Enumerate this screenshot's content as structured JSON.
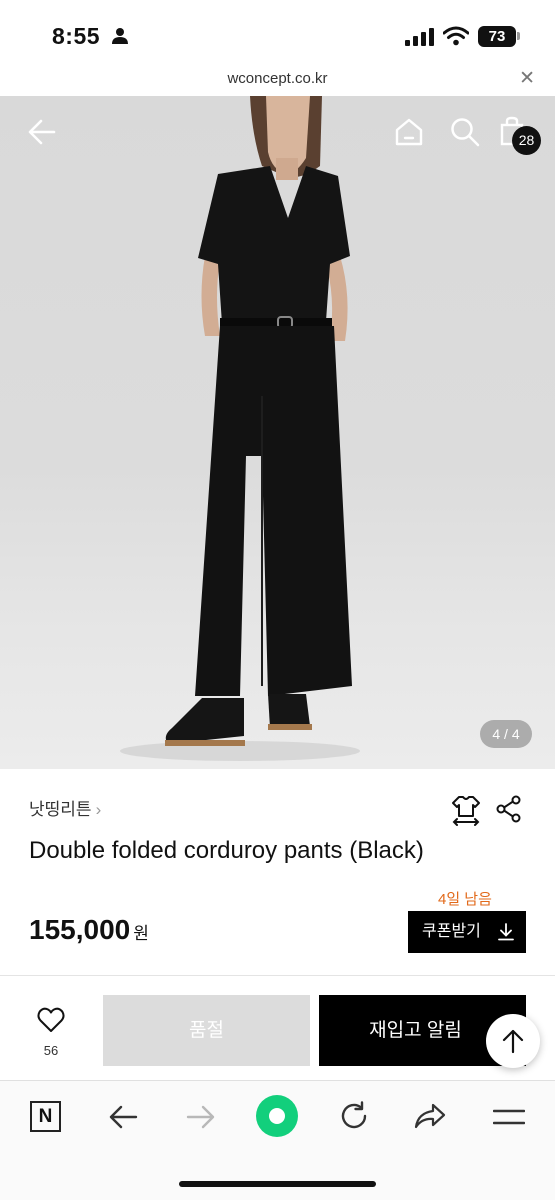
{
  "status_bar": {
    "time": "8:55",
    "battery": "73"
  },
  "browser": {
    "url": "wconcept.co.kr"
  },
  "hero": {
    "cart_count": "28",
    "page_indicator": "4 / 4"
  },
  "product": {
    "brand": "낫띵리튼",
    "title": "Double folded corduroy pants (Black)",
    "days_left": "4일 남음",
    "price": "155,000",
    "currency": "원",
    "coupon_label": "쿠폰받기"
  },
  "actions": {
    "wish_count": "56",
    "soldout_label": "품절",
    "restock_label": "재입고 알림"
  },
  "toolbar": {
    "n_label": "N"
  },
  "colors": {
    "accent_orange": "#e26a1b",
    "naver_green": "#12cf7c",
    "black": "#000000"
  },
  "icons": [
    "person-icon",
    "signal-icon",
    "wifi-icon",
    "close-icon",
    "back-arrow-icon",
    "home-icon",
    "search-icon",
    "bag-icon",
    "chevron-right-icon",
    "size-guide-icon",
    "share-icon",
    "download-icon",
    "heart-icon",
    "arrow-up-icon",
    "forward-arrow-icon",
    "refresh-icon",
    "share-arrow-icon",
    "menu-icon"
  ]
}
